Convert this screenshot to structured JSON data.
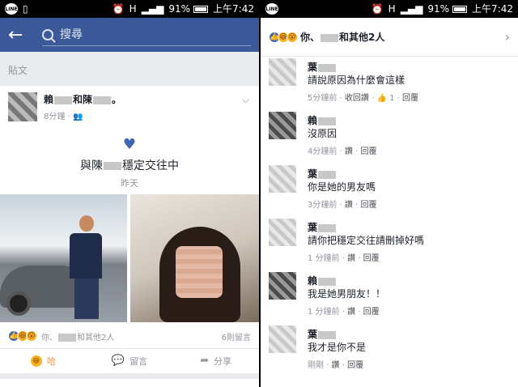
{
  "status_bar": {
    "battery": "91%",
    "time": "上午7:42",
    "line_label": "LINE",
    "battery_level": 0.91
  },
  "header": {
    "search_placeholder": "搜尋"
  },
  "section_label": "貼文",
  "post": {
    "author1": "賴",
    "and": "和",
    "author2": "陳",
    "suffix": "。",
    "time": "8分鐘",
    "event_title_prefix": "與陳",
    "event_title_suffix": "穩定交往中",
    "event_date": "昨天",
    "reactions": {
      "prefix": "你、",
      "suffix": "和其他2人",
      "comment_count": "6則留言"
    },
    "actions": {
      "haha": "哈",
      "comment": "留言",
      "share": "分享"
    }
  },
  "comments_panel": {
    "header_prefix": "你、",
    "header_suffix": "和其他2人",
    "comments": [
      {
        "name": "葉",
        "text": "請說原因為什麼會這樣",
        "time": "5分鐘前",
        "action": "收回讚",
        "likes": "1",
        "reply": "回覆"
      },
      {
        "name": "賴",
        "text": "沒原因",
        "time": "4分鐘前",
        "action": "讚",
        "reply": "回覆"
      },
      {
        "name": "葉",
        "text": "你是她的男友嗎",
        "time": "3分鐘前",
        "action": "讚",
        "reply": "回覆"
      },
      {
        "name": "葉",
        "text": "請你把穩定交往請刪掉好嗎",
        "time": "1 分鐘前",
        "action": "讚",
        "reply": "回覆"
      },
      {
        "name": "賴",
        "text": "我是她男朋友！！",
        "time": "1 分鐘前",
        "action": "讚",
        "reply": "回覆"
      },
      {
        "name": "葉",
        "text": "我才是你不是",
        "time": "剛剛",
        "action": "讚",
        "reply": "回覆"
      }
    ]
  }
}
